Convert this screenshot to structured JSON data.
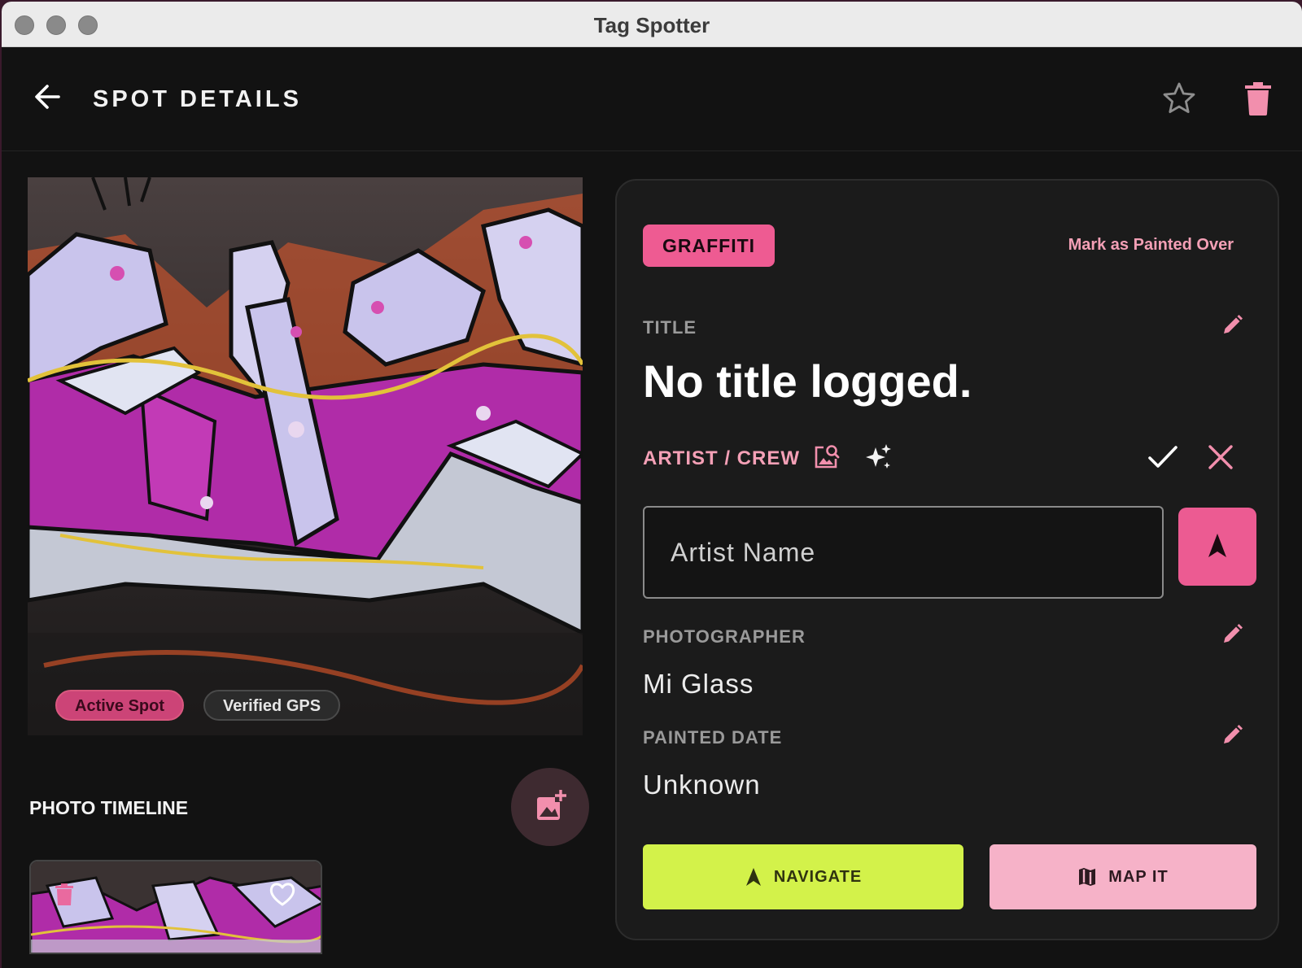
{
  "window": {
    "title": "Tag Spotter"
  },
  "header": {
    "title": "SPOT DETAILS"
  },
  "photo": {
    "chips": {
      "active": "Active Spot",
      "gps": "Verified GPS"
    }
  },
  "timeline": {
    "label": "PHOTO TIMELINE"
  },
  "details": {
    "category_badge": "GRAFFITI",
    "mark_painted_over": "Mark as Painted Over",
    "title_label": "TITLE",
    "title_value": "No title logged.",
    "artist_label": "ARTIST / CREW",
    "artist_placeholder": "Artist Name",
    "artist_value": "",
    "photographer_label": "PHOTOGRAPHER",
    "photographer_value": "Mi Glass",
    "painted_date_label": "PAINTED DATE",
    "painted_date_value": "Unknown",
    "navigate_label": "NAVIGATE",
    "map_label": "MAP IT"
  },
  "colors": {
    "accent_pink": "#ee5b92",
    "light_pink": "#f6b2c8",
    "lime": "#d3f24a",
    "background": "#121212",
    "card": "#1b1b1b"
  },
  "icons": [
    "back-arrow-icon",
    "star-icon",
    "trash-icon",
    "edit-icon",
    "image-search-icon",
    "sparkle-icon",
    "check-icon",
    "close-icon",
    "navigation-arrow-icon",
    "add-photo-icon",
    "heart-icon",
    "map-icon"
  ]
}
